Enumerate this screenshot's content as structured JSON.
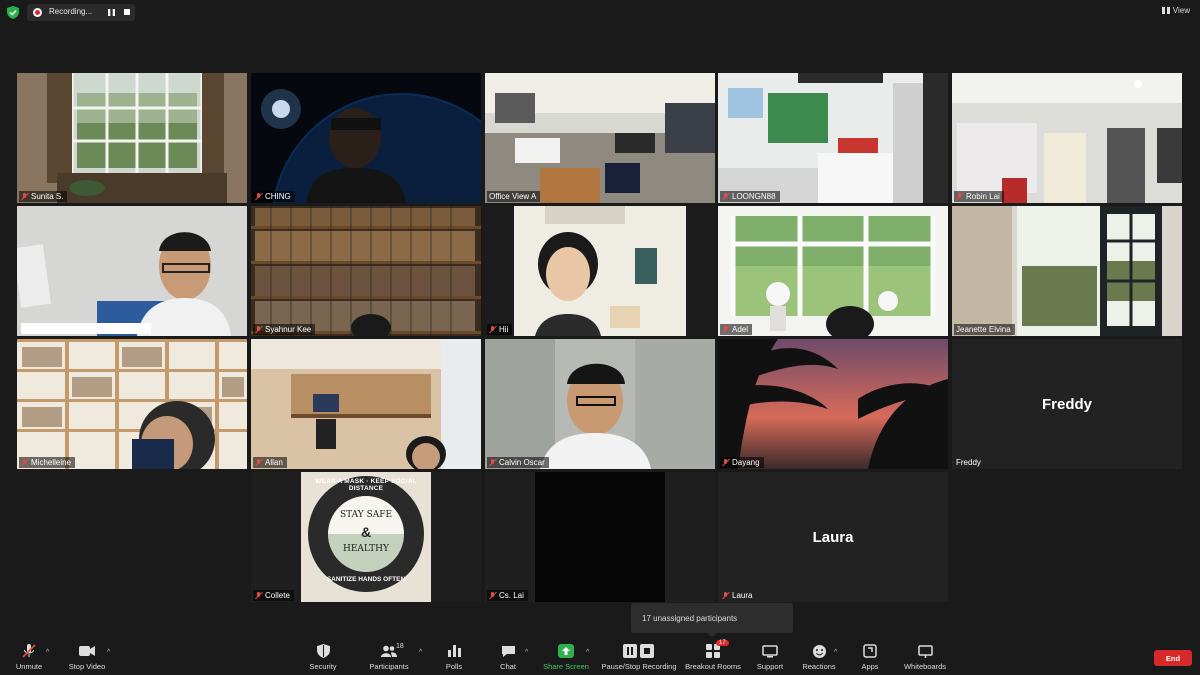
{
  "top_bar": {
    "recording_label": "Recording...",
    "view_label": "View"
  },
  "tiles": [
    {
      "name": "Sunita S.",
      "muted": true
    },
    {
      "name": "CHING",
      "muted": true
    },
    {
      "name": "Office View A",
      "muted": false
    },
    {
      "name": "LOONGN88",
      "muted": true
    },
    {
      "name": "Robin Lai",
      "muted": true
    },
    {
      "name": "",
      "muted": false,
      "active_speaker": true
    },
    {
      "name": "Syahnur Kee",
      "muted": true
    },
    {
      "name": "Hii",
      "muted": true
    },
    {
      "name": "Adel",
      "muted": true
    },
    {
      "name": "Jeanette Elvina",
      "muted": false
    },
    {
      "name": "Michelleine",
      "muted": true
    },
    {
      "name": "Allan",
      "muted": true
    },
    {
      "name": "Calvin Oscar",
      "muted": true
    },
    {
      "name": "Dayang",
      "muted": true
    },
    {
      "name": "Freddy",
      "muted": false,
      "display_name": "Freddy"
    },
    {
      "name": "Collete",
      "muted": true
    },
    {
      "name": "Cs. Lai",
      "muted": true
    },
    {
      "name": "Laura",
      "muted": true,
      "display_name": "Laura"
    }
  ],
  "poster": {
    "top_arc": "WEAR A MASK · KEEP SOCIAL DISTANCE",
    "bottom_arc": "SANITIZE HANDS OFTEN",
    "center_lines": [
      "STAY SAFE",
      "&",
      "HEALTHY"
    ]
  },
  "tooltip": "17 unassigned participants",
  "toolbar": {
    "unmute": "Unmute",
    "stop_video": "Stop Video",
    "security": "Security",
    "participants": "Participants",
    "participants_count": "18",
    "polls": "Polls",
    "chat": "Chat",
    "share_screen": "Share Screen",
    "pause_stop_recording": "Pause/Stop Recording",
    "breakout_rooms": "Breakout Rooms",
    "breakout_badge": "17",
    "support": "Support",
    "reactions": "Reactions",
    "apps": "Apps",
    "whiteboards": "Whiteboards",
    "end": "End"
  },
  "colors": {
    "background": "#1a1a1a",
    "active_speaker_border": "#c6e25a",
    "muted_red": "#e24b4b",
    "share_green": "#42c85f",
    "end_red": "#d62a2a"
  }
}
